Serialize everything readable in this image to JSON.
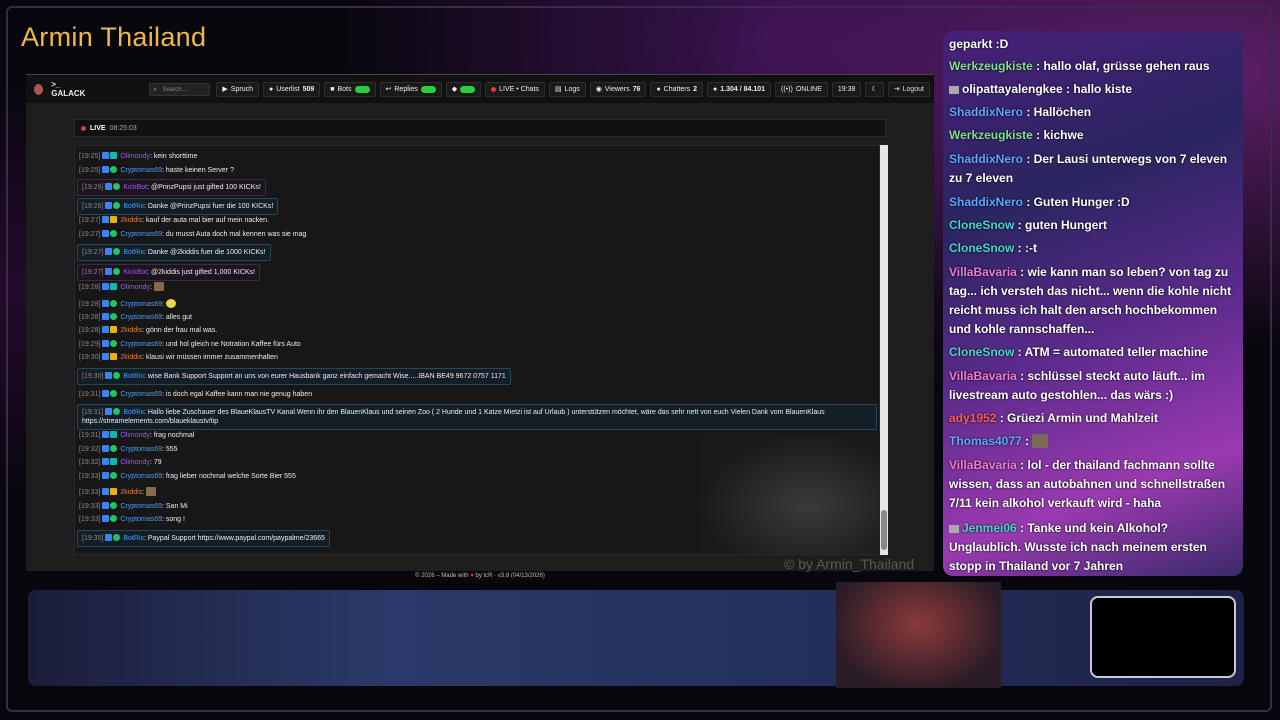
{
  "channel": {
    "title": "Armin Thailand",
    "watermark": "© by Armin_Thailand"
  },
  "app": {
    "brand": ">_ GALACK",
    "search_placeholder": "Search...",
    "toolbar": {
      "spruch": "Spruch",
      "userlist": "Userlist",
      "userlist_count": "509",
      "bots": "Bots",
      "replies": "Replies",
      "live_chats": "LIVE • Chats",
      "logs": "Logs",
      "viewers": "Viewers",
      "viewers_count": "76",
      "chatters": "Chatters",
      "chatters_count": "2",
      "messages": "1.304 / 84.101",
      "online": "ONLINE",
      "clock": "19:38",
      "logout": "Logout"
    },
    "live": {
      "label": "LIVE",
      "time": "08:25:03"
    },
    "messages": [
      {
        "ts": "[19:25]",
        "user": "Olimondy",
        "text": ": kein shorttime"
      },
      {
        "ts": "[19:25]",
        "user": "Cryptomas69",
        "text": ": haste keinen Server ?"
      },
      {
        "ts": "[19:26]",
        "user": "KickBot",
        "text": ": @PrinzPupsi just gifted 100 KICKs!"
      },
      {
        "ts": "[19:26]",
        "user": "BotRix",
        "text": ": Danke @PrinzPupsi fuer die 100 KICKs!"
      },
      {
        "ts": "[19:27]",
        "user": "2kiddis",
        "text": ": kauf der auta mal bier auf mein nacken."
      },
      {
        "ts": "[19:27]",
        "user": "Cryptomas69",
        "text": ": du musst Auta doch mal kennen was sie mag"
      },
      {
        "ts": "[19:27]",
        "user": "BotRix",
        "text": ": Danke @2kiddis fuer die 1000 KICKs!"
      },
      {
        "ts": "[19:27]",
        "user": "KickBot",
        "text": ": @2kiddis just gifted 1,000 KICKs!"
      },
      {
        "ts": "[19:28]",
        "user": "Olimondy",
        "text": ":"
      },
      {
        "ts": "[19:28]",
        "user": "Cryptomas69",
        "text": ":"
      },
      {
        "ts": "[19:28]",
        "user": "Cryptomas69",
        "text": ": alles gut"
      },
      {
        "ts": "[19:28]",
        "user": "2kiddis",
        "text": ": gönn der frau mal was."
      },
      {
        "ts": "[19:29]",
        "user": "Cryptomas69",
        "text": ": und hol gleich ne Notration Kaffee fürs Auto"
      },
      {
        "ts": "[19:30]",
        "user": "2kiddis",
        "text": ": klausi wir müssen immer zusammenhalten"
      },
      {
        "ts": "[19:30]",
        "user": "BotRix",
        "text": ": wise Bank Support Support an uns von eurer Hausbank ganz einfach gemacht Wise.....IBAN BE49 9672 0757 1171"
      },
      {
        "ts": "[19:31]",
        "user": "Cryptomas69",
        "text": ": is doch egal Kaffee kann man nie genug haben"
      },
      {
        "ts": "[19:31]",
        "user": "BotRix",
        "text": ": Hallo liebe Zuschauer des BlaueKlausTV Kanal.Wenn ihr den BlauenKlaus und seinen Zoo ( 2 Hunde und 1 Katze Mietzi ist auf Urlaub ) unterstützen möchtet, wäre das sehr nett von euch Vielen Dank vom BlauenKlaus https://streamelements.com/blaueklaustv/tip"
      },
      {
        "ts": "[19:31]",
        "user": "Olimondy",
        "text": ": frag nochmal"
      },
      {
        "ts": "[19:32]",
        "user": "Cryptomas69",
        "text": ": 555"
      },
      {
        "ts": "[19:32]",
        "user": "Olimondy",
        "text": ": 79"
      },
      {
        "ts": "[19:33]",
        "user": "Cryptomas69",
        "text": ": frag lieber nochmal welche Sorte Bier 555"
      },
      {
        "ts": "[19:33]",
        "user": "2kiddis",
        "text": ":"
      },
      {
        "ts": "[19:33]",
        "user": "Cryptomas69",
        "text": ": San Mi"
      },
      {
        "ts": "[19:33]",
        "user": "Cryptomas69",
        "text": ": song !"
      },
      {
        "ts": "[19:35]",
        "user": "BotRix",
        "text": ": Paypal Support https://www.paypal.com/paypalme/23665"
      }
    ],
    "footer": {
      "prefix": "© 2026 – Made with",
      "suffix": "by tcR · v3.8 (04/13/2026)"
    }
  },
  "overlay_chat": [
    {
      "user": "",
      "text": "geparkt :D"
    },
    {
      "user": "Werkzeugkiste",
      "text": " : hallo olaf, grüsse gehen raus"
    },
    {
      "user": "olipattayalengkee",
      "text": " : hallo kiste"
    },
    {
      "user": "ShaddixNero",
      "text": " : Hallöchen"
    },
    {
      "user": "Werkzeugkiste",
      "text": " : kichwe"
    },
    {
      "user": "ShaddixNero",
      "text": " : Der Lausi unterwegs von 7 eleven zu 7 eleven"
    },
    {
      "user": "ShaddixNero",
      "text": " : Guten Hunger :D"
    },
    {
      "user": "CloneSnow",
      "text": " : guten Hungert"
    },
    {
      "user": "CloneSnow",
      "text": " : :-t"
    },
    {
      "user": "VillaBavaria",
      "text": " : wie kann man so leben? von tag zu tag... ich versteh das nicht... wenn die kohle nicht reicht muss ich halt den arsch hochbekommen und kohle rannschaffen..."
    },
    {
      "user": "CloneSnow",
      "text": " : ATM = automated teller machine"
    },
    {
      "user": "VillaBavaria",
      "text": " : schlüssel steckt auto läuft... im livestream auto gestohlen... das wärs :)"
    },
    {
      "user": "ady1952",
      "text": " : Grüezi Armin und Mahlzeit"
    },
    {
      "user": "Thomas4077",
      "text": " :"
    },
    {
      "user": "VillaBavaria",
      "text": " : lol - der thailand fachmann sollte wissen, dass an autobahnen und schnellstraßen 7/11 kein alkohol verkauft wird - haha"
    },
    {
      "user": "Jenmei06",
      "text": " : Tanke und kein Alkohol? Unglaublich. Wusste ich nach meinem ersten stopp in Thailand vor 7 Jahren"
    }
  ]
}
